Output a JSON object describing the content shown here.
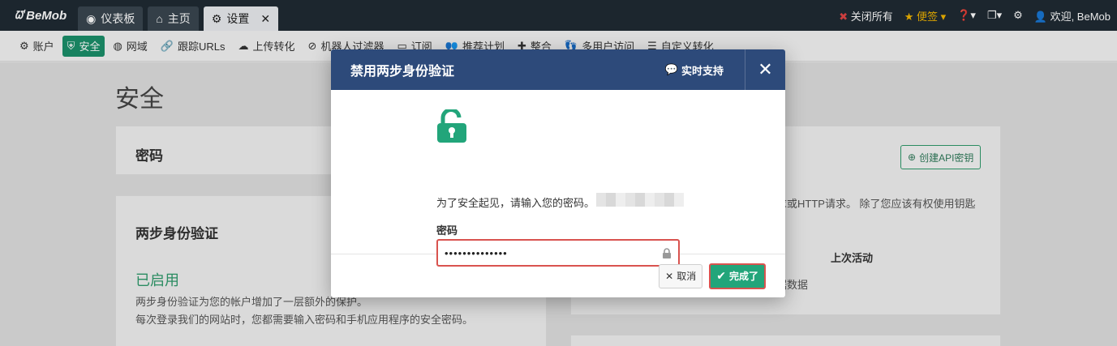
{
  "topbar": {
    "logo": "BeMob",
    "tabs": [
      {
        "label": "仪表板",
        "icon": "dashboard-icon"
      },
      {
        "label": "主页",
        "icon": "home-icon"
      },
      {
        "label": "设置",
        "icon": "gear-icon"
      }
    ],
    "close_all": "关闭所有",
    "notes": "便签",
    "greeting": "欢迎, BeMob"
  },
  "subnav": {
    "items": [
      {
        "label": "账户",
        "icon": "gear-icon"
      },
      {
        "label": "安全",
        "icon": "shield-icon"
      },
      {
        "label": "网域",
        "icon": "globe-icon"
      },
      {
        "label": "跟踪URLs",
        "icon": "link-icon"
      },
      {
        "label": "上传转化",
        "icon": "cloud-upload-icon"
      },
      {
        "label": "机器人过滤器",
        "icon": "ban-icon"
      },
      {
        "label": "订阅",
        "icon": "credit-card-icon"
      },
      {
        "label": "推荐计划",
        "icon": "users-icon"
      },
      {
        "label": "整合",
        "icon": "puzzle-icon"
      },
      {
        "label": "多用户访问",
        "icon": "user-group-icon"
      },
      {
        "label": "自定义转化",
        "icon": "list-icon"
      }
    ]
  },
  "page": {
    "title": "安全",
    "password_card": {
      "heading": "密码"
    },
    "twofa_card": {
      "heading": "两步身份验证",
      "status": "已启用",
      "desc1": "两步身份验证为您的帐户增加了一层额外的保护。",
      "desc2": "每次登录我们的网站时，您都需要输入密码和手机应用程序的安全密码。"
    },
    "api_card": {
      "create_button": "创建API密钥",
      "desc": "求或HTTP请求。 除了您应该有权使用钥匙",
      "col_last_activity": "上次活动",
      "no_data": "据数据"
    }
  },
  "modal": {
    "title": "禁用两步身份验证",
    "support": "实时支持",
    "prompt": "为了安全起见，请输入您的密码。",
    "password_label": "密码",
    "password_value": "••••••••••••••",
    "cancel": "取消",
    "done": "完成了"
  }
}
